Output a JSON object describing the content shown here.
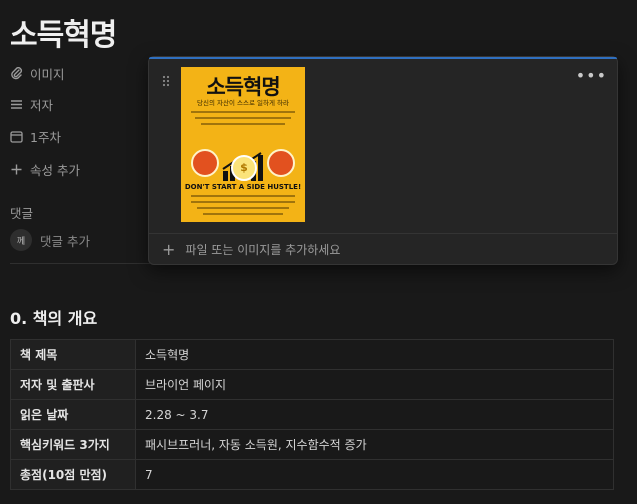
{
  "page": {
    "title": "소득혁명"
  },
  "properties": [
    {
      "icon": "paperclip-icon",
      "label": "이미지"
    },
    {
      "icon": "list-icon",
      "label": "저자"
    },
    {
      "icon": "calendar-icon",
      "label": "1주차"
    },
    {
      "icon": "plus-icon",
      "label": "속성 추가"
    }
  ],
  "comments": {
    "label": "댓글",
    "avatar_initial": "께",
    "add_placeholder": "댓글 추가"
  },
  "image_popover": {
    "more_label": "•••",
    "add_file_label": "파일 또는 이미지를 추가하세요",
    "book_cover": {
      "title": "소득혁명",
      "subtitle": "당신의 자산이 스스로 일하게 하라",
      "english_tagline": "DON'T START A SIDE HUSTLE!",
      "coin_symbol": "$"
    }
  },
  "section": {
    "heading": "0. 책의 개요"
  },
  "summary_table": {
    "rows": [
      {
        "label": "책 제목",
        "value": "소득혁명"
      },
      {
        "label": "저자 및 출판사",
        "value": "브라이언 페이지"
      },
      {
        "label": "읽은 날짜",
        "value": "2.28 ~ 3.7"
      },
      {
        "label": "핵심키워드 3가지",
        "value": "패시브프러너, 자동 소득원, 지수함수적 증가"
      },
      {
        "label": "총점(10점 만점)",
        "value": "7"
      }
    ]
  },
  "colors": {
    "background": "#191919",
    "accent_focus": "#2f6fbf",
    "book_cover": "#f3b316"
  }
}
